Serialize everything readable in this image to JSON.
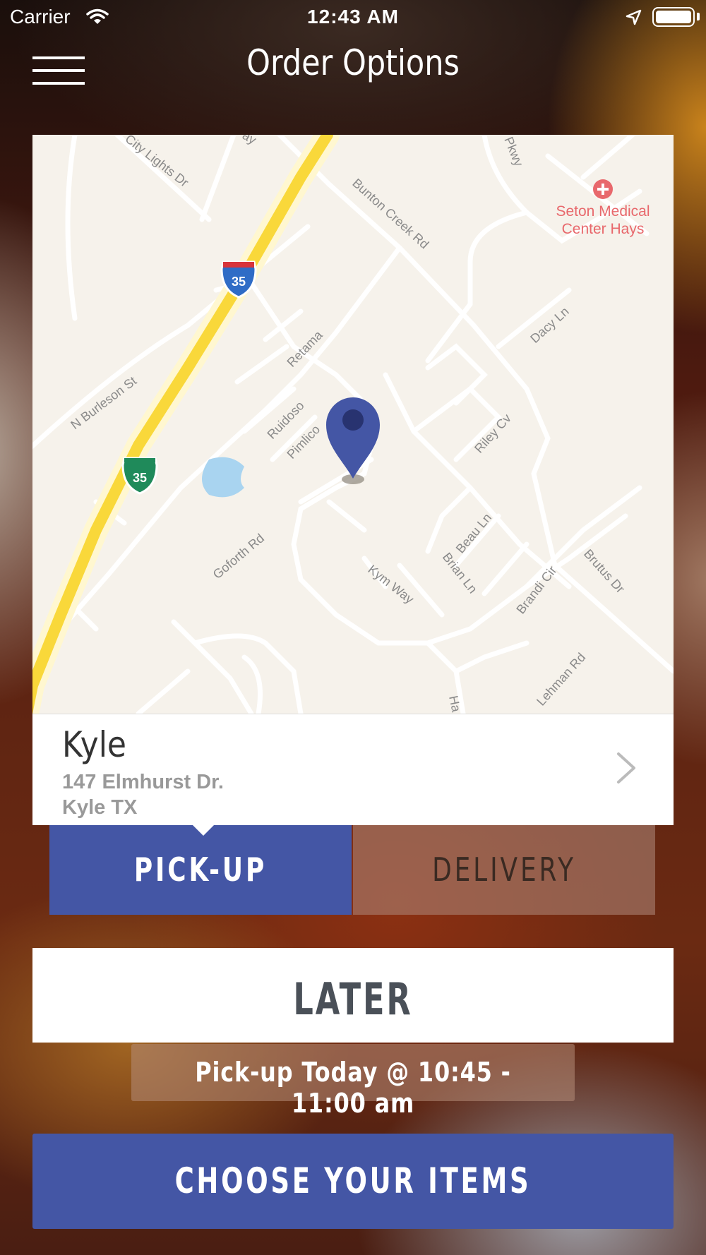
{
  "status_bar": {
    "carrier": "Carrier",
    "time": "12:43 AM"
  },
  "header": {
    "title": "Order Options",
    "menu_icon": "hamburger-menu-icon"
  },
  "map": {
    "interstate_shield": "35",
    "poi": [
      "Seton Medical",
      "Center Hays"
    ],
    "streets": {
      "city_lights": "City Lights Dr",
      "way_partial": "ay",
      "bunton": "Bunton Creek Rd",
      "pkwy": "Pkwy",
      "dacy": "Dacy Ln",
      "n_burleson": "N Burleson St",
      "retama": "Retama",
      "ruidoso": "Ruidoso",
      "pimlico": "Pimlico",
      "riley": "Riley Cv",
      "goforth": "Goforth Rd",
      "beau": "Beau Ln",
      "brian": "Brian Ln",
      "brandi": "Brandi Cir",
      "brutus": "Brutus Dr",
      "kym": "Kym Way",
      "lehman": "Lehman Rd",
      "ha_partial": "Ha"
    },
    "colors": {
      "background": "#f6f2eb",
      "interstate": "#f9d83a",
      "pin": "#4456a5",
      "water": "#a9d4f0",
      "poi": "#e8686c"
    }
  },
  "location": {
    "name": "Kyle",
    "address_line1": "147 Elmhurst Dr.",
    "address_line2": "Kyle TX"
  },
  "order_type": {
    "pickup_label": "PICK-UP",
    "delivery_label": "DELIVERY",
    "selected": "PICK-UP"
  },
  "timing": {
    "later_label": "LATER",
    "pickup_time": "Pick-up Today @ 10:45 - 11:00 am"
  },
  "actions": {
    "choose_items": "CHOOSE YOUR ITEMS"
  },
  "colors": {
    "accent": "#4456a5",
    "text_dark": "#4a5058"
  }
}
